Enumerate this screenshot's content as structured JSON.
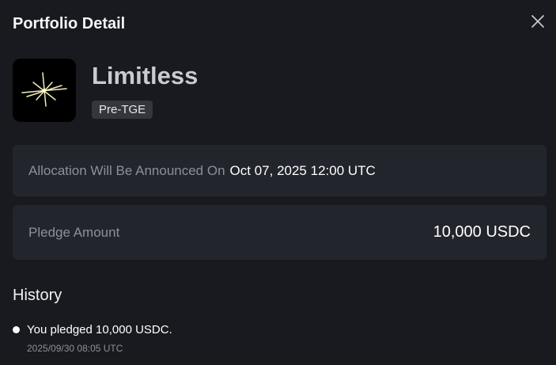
{
  "header": {
    "title": "Portfolio Detail"
  },
  "project": {
    "name": "Limitless",
    "badge": "Pre-TGE"
  },
  "allocation": {
    "label": "Allocation Will Be Announced On",
    "value": "Oct 07, 2025 12:00 UTC"
  },
  "pledge": {
    "label": "Pledge Amount",
    "value": "10,000 USDC"
  },
  "history": {
    "title": "History",
    "items": [
      {
        "text": "You pledged 10,000 USDC.",
        "time": "2025/09/30 08:05 UTC"
      }
    ]
  },
  "icons": {
    "close": "close-icon",
    "logo": "limitless-logo-icon"
  },
  "colors": {
    "background": "#181a1f",
    "card": "#22252b",
    "badge": "#33363d",
    "muted_text": "#8d9098",
    "logo_accent": "#f2efb8"
  }
}
